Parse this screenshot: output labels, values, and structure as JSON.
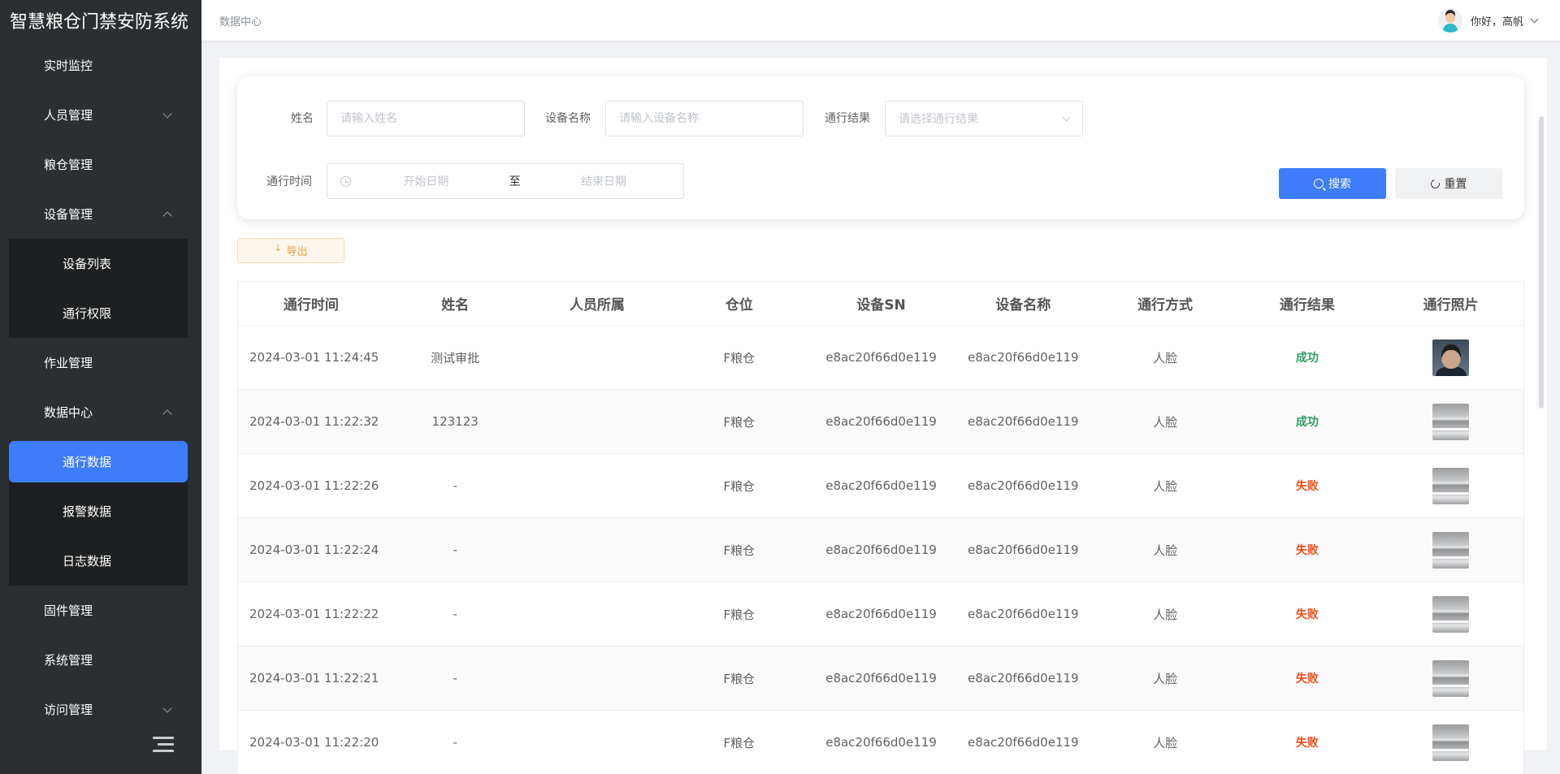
{
  "app": {
    "title": "智慧粮仓门禁安防系统"
  },
  "sidebar": {
    "items": [
      {
        "label": "实时监控",
        "expandable": false
      },
      {
        "label": "人员管理",
        "expandable": true,
        "expanded": false
      },
      {
        "label": "粮仓管理",
        "expandable": false
      },
      {
        "label": "设备管理",
        "expandable": true,
        "expanded": true,
        "children": [
          {
            "label": "设备列表"
          },
          {
            "label": "通行权限"
          }
        ]
      },
      {
        "label": "作业管理",
        "expandable": false
      },
      {
        "label": "数据中心",
        "expandable": true,
        "expanded": true,
        "children": [
          {
            "label": "通行数据",
            "active": true
          },
          {
            "label": "报警数据"
          },
          {
            "label": "日志数据"
          }
        ]
      },
      {
        "label": "固件管理",
        "expandable": false
      },
      {
        "label": "系统管理",
        "expandable": false
      },
      {
        "label": "访问管理",
        "expandable": true,
        "expanded": false
      }
    ],
    "collapse_icon": "menu-fold-icon"
  },
  "header": {
    "breadcrumb": "数据中心",
    "greeting": "你好，高帆"
  },
  "filters": {
    "name_label": "姓名",
    "name_placeholder": "请输入姓名",
    "device_label": "设备名称",
    "device_placeholder": "请输入设备名称",
    "result_label": "通行结果",
    "result_placeholder": "请选择通行结果",
    "time_label": "通行时间",
    "start_placeholder": "开始日期",
    "range_separator": "至",
    "end_placeholder": "结束日期",
    "search_button": "搜索",
    "reset_button": "重置"
  },
  "toolbar": {
    "export_button": "导出"
  },
  "table": {
    "columns": [
      "通行时间",
      "姓名",
      "人员所属",
      "仓位",
      "设备SN",
      "设备名称",
      "通行方式",
      "通行结果",
      "通行照片"
    ],
    "rows": [
      {
        "time": "2024-03-01 11:24:45",
        "name": "测试审批",
        "org": "",
        "bin": "F粮仓",
        "sn": "e8ac20f66d0e119",
        "device": "e8ac20f66d0e119",
        "method": "人脸",
        "result": "成功",
        "status": "ok",
        "photo": "person"
      },
      {
        "time": "2024-03-01 11:22:32",
        "name": "123123",
        "org": "",
        "bin": "F粮仓",
        "sn": "e8ac20f66d0e119",
        "device": "e8ac20f66d0e119",
        "method": "人脸",
        "result": "成功",
        "status": "ok",
        "photo": "ceiling"
      },
      {
        "time": "2024-03-01 11:22:26",
        "name": "-",
        "org": "",
        "bin": "F粮仓",
        "sn": "e8ac20f66d0e119",
        "device": "e8ac20f66d0e119",
        "method": "人脸",
        "result": "失败",
        "status": "fail",
        "photo": "ceiling"
      },
      {
        "time": "2024-03-01 11:22:24",
        "name": "-",
        "org": "",
        "bin": "F粮仓",
        "sn": "e8ac20f66d0e119",
        "device": "e8ac20f66d0e119",
        "method": "人脸",
        "result": "失败",
        "status": "fail",
        "photo": "ceiling"
      },
      {
        "time": "2024-03-01 11:22:22",
        "name": "-",
        "org": "",
        "bin": "F粮仓",
        "sn": "e8ac20f66d0e119",
        "device": "e8ac20f66d0e119",
        "method": "人脸",
        "result": "失败",
        "status": "fail",
        "photo": "ceiling"
      },
      {
        "time": "2024-03-01 11:22:21",
        "name": "-",
        "org": "",
        "bin": "F粮仓",
        "sn": "e8ac20f66d0e119",
        "device": "e8ac20f66d0e119",
        "method": "人脸",
        "result": "失败",
        "status": "fail",
        "photo": "ceiling"
      },
      {
        "time": "2024-03-01 11:22:20",
        "name": "-",
        "org": "",
        "bin": "F粮仓",
        "sn": "e8ac20f66d0e119",
        "device": "e8ac20f66d0e119",
        "method": "人脸",
        "result": "失败",
        "status": "fail",
        "photo": "ceiling"
      }
    ]
  },
  "colors": {
    "sidebar_bg": "#2b2f31",
    "accent": "#3d7dfb",
    "success": "#2e9e5e",
    "fail": "#f04e1a",
    "export": "#e6a23c"
  }
}
